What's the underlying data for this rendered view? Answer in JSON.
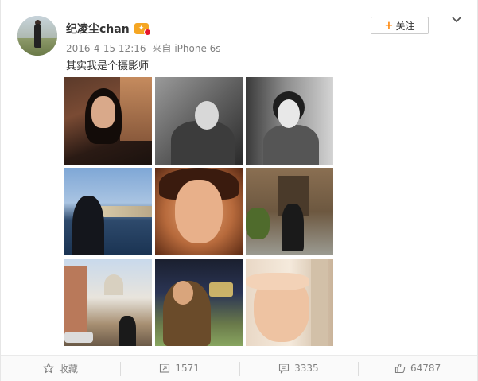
{
  "post": {
    "username": "纪凌尘chan",
    "timestamp": "2016-4-15 12:16",
    "source_prefix": "来自",
    "source": "iPhone 6s",
    "text": "其实我是个摄影师",
    "follow_label": "关注",
    "follow_plus": "+"
  },
  "icons": {
    "verified_badge": "vip-badge-icon",
    "more": "chevron-down-icon",
    "favorite": "star-icon",
    "repost": "repost-icon",
    "comment": "comment-icon",
    "like": "thumbs-up-icon"
  },
  "colors": {
    "accent": "#ff8200",
    "badge": "#f5a623",
    "text": "#333333",
    "muted": "#808080"
  },
  "actions": {
    "favorite_label": "收藏",
    "repost_count": "1571",
    "comment_count": "3335",
    "like_count": "64787"
  }
}
